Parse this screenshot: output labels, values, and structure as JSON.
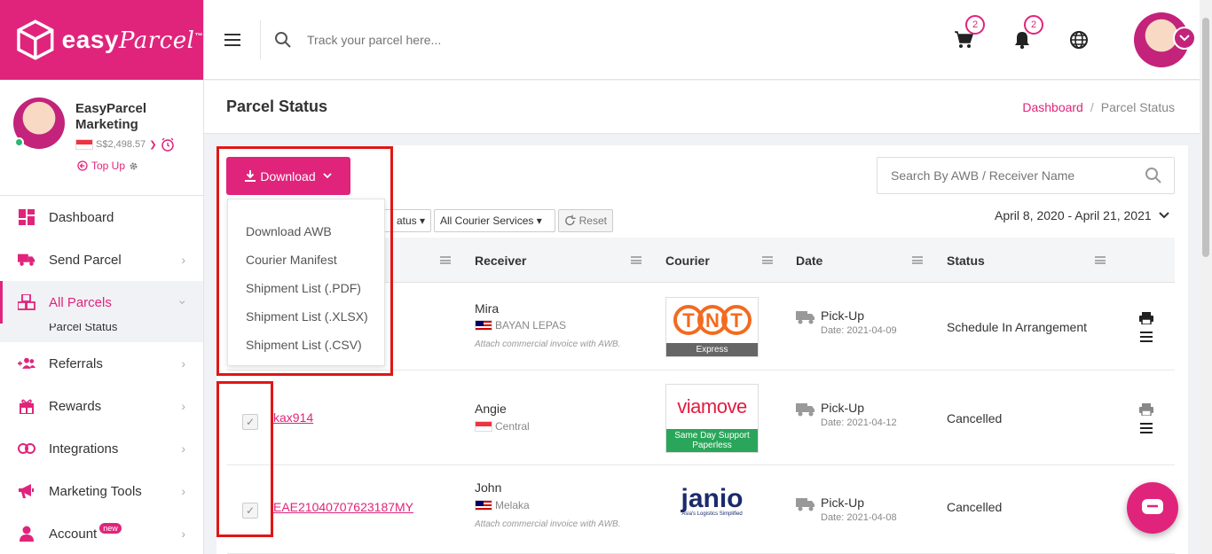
{
  "brand": {
    "name": "easy",
    "script": "Parcel",
    "tm": "™",
    "color": "#e0247b"
  },
  "profile": {
    "name": "EasyParcel Marketing",
    "balance": "S$2,498.57",
    "topup_label": "Top Up"
  },
  "sidebar": {
    "items": [
      {
        "label": "Dashboard",
        "icon": "dashboard-icon"
      },
      {
        "label": "Send Parcel",
        "icon": "truck-icon"
      },
      {
        "label": "All Parcels",
        "icon": "boxes-icon",
        "active": true
      },
      {
        "label": "Referrals",
        "icon": "add-users-icon"
      },
      {
        "label": "Rewards",
        "icon": "gift-icon"
      },
      {
        "label": "Integrations",
        "icon": "link-icon"
      },
      {
        "label": "Marketing Tools",
        "icon": "megaphone-icon"
      },
      {
        "label": "Account",
        "icon": "user-icon",
        "badge": "new"
      }
    ],
    "subitem": "Parcel Status"
  },
  "topbar": {
    "search_placeholder": "Track your parcel here...",
    "cart_count": "2",
    "notif_count": "2"
  },
  "page": {
    "title": "Parcel Status",
    "breadcrumb": [
      "Dashboard",
      "Parcel Status"
    ]
  },
  "toolbar": {
    "download_label": "Download",
    "download_menu": [
      "Download AWB",
      "Courier Manifest",
      "Shipment List (.PDF)",
      "Shipment List (.XLSX)",
      "Shipment List (.CSV)"
    ],
    "awb_search_placeholder": "Search By AWB / Receiver Name",
    "status_filter_label": "atus",
    "courier_filter_label": "All Courier Services",
    "reset_label": "Reset",
    "date_range": "April 8, 2020 - April 21, 2021"
  },
  "table": {
    "columns": [
      "Receiver",
      "Courier",
      "Date",
      "Status"
    ],
    "rows": [
      {
        "awb": "",
        "receiver": "Mira",
        "location": "BAYAN LEPAS",
        "note": "Attach commercial invoice with AWB.",
        "courier": "TNT",
        "courier_tag": "Express",
        "date_label": "Pick-Up",
        "date": "Date: 2021-04-09",
        "status": "Schedule In Arrangement"
      },
      {
        "awb": "kax914",
        "receiver": "Angie",
        "location": "Central",
        "note": "",
        "courier": "viamove",
        "courier_tag": "Same Day Support Paperless",
        "date_label": "Pick-Up",
        "date": "Date: 2021-04-12",
        "status": "Cancelled"
      },
      {
        "awb": "EAE21040707623187MY",
        "receiver": "John",
        "location": "Melaka",
        "note": "Attach commercial invoice with AWB.",
        "courier": "janio",
        "courier_tag": "Asia's Logistics Simplified",
        "date_label": "Pick-Up",
        "date": "Date: 2021-04-08",
        "status": "Cancelled"
      }
    ]
  },
  "colors": {
    "accent": "#e0247b",
    "highlight": "#e01616",
    "green_tag": "#2aa65a",
    "gray_tag": "#666666"
  }
}
